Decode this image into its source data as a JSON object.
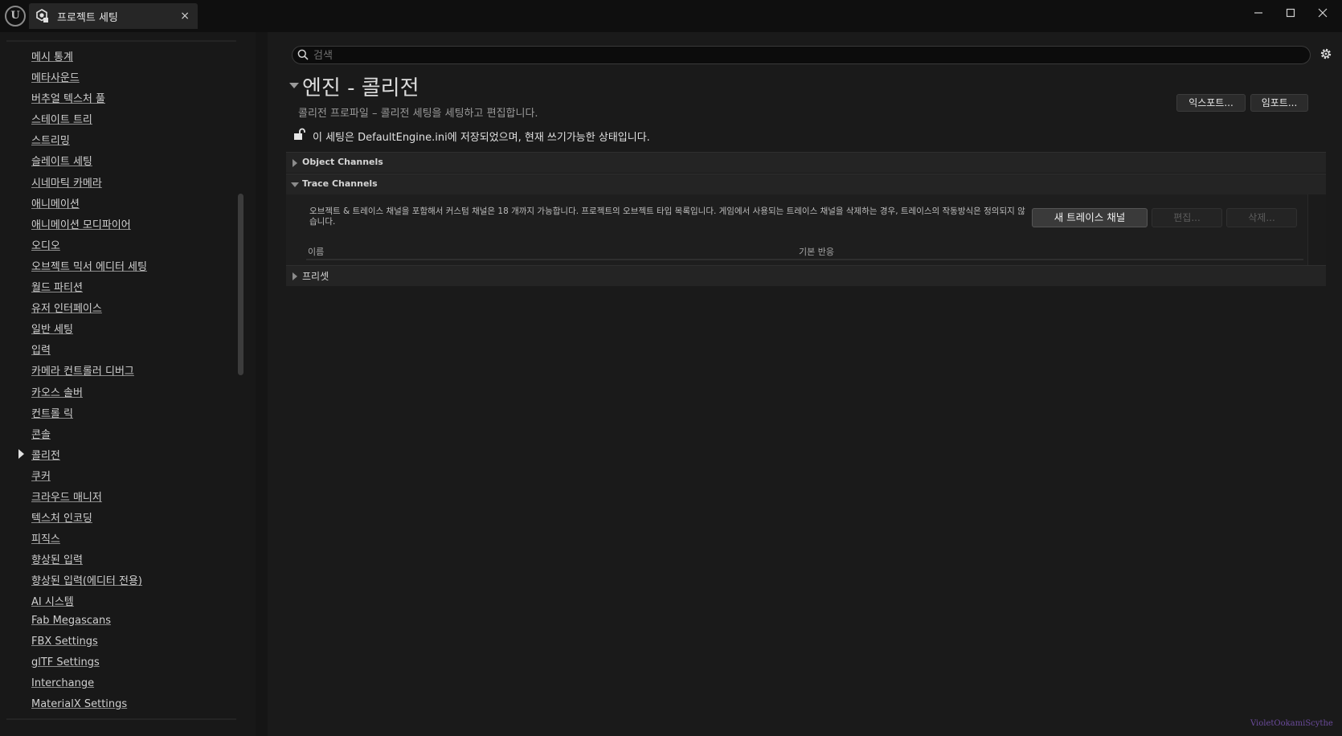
{
  "titlebar": {
    "tab_label": "프로젝트 세팅",
    "tab_close": "×",
    "logo_text": "U"
  },
  "sidebar": {
    "items": [
      {
        "label": "메시 통계"
      },
      {
        "label": "메타사운드"
      },
      {
        "label": "버추얼 텍스처 풀"
      },
      {
        "label": "스테이트 트리"
      },
      {
        "label": "스트리밍"
      },
      {
        "label": "슬레이트 세팅"
      },
      {
        "label": "시네마틱 카메라"
      },
      {
        "label": "애니메이션"
      },
      {
        "label": "애니메이션 모디파이어"
      },
      {
        "label": "오디오"
      },
      {
        "label": "오브젝트 믹서 에디터 세팅"
      },
      {
        "label": "월드 파티션"
      },
      {
        "label": "유저 인터페이스"
      },
      {
        "label": "일반 세팅"
      },
      {
        "label": "입력"
      },
      {
        "label": "카메라 컨트롤러 디버그"
      },
      {
        "label": "카오스 솔버"
      },
      {
        "label": "컨트롤 릭"
      },
      {
        "label": "콘솔"
      },
      {
        "label": "콜리전",
        "selected": true
      },
      {
        "label": "쿠커"
      },
      {
        "label": "크라우드 매니저"
      },
      {
        "label": "텍스처 인코딩"
      },
      {
        "label": "피직스"
      },
      {
        "label": "향상된 입력"
      },
      {
        "label": "향상된 입력(에디터 전용)"
      },
      {
        "label": "AI 시스템"
      },
      {
        "label": "Fab Megascans"
      },
      {
        "label": "FBX Settings"
      },
      {
        "label": "glTF Settings"
      },
      {
        "label": "Interchange"
      },
      {
        "label": "MaterialX Settings"
      }
    ]
  },
  "search": {
    "placeholder": "검색",
    "value": ""
  },
  "page": {
    "title": "엔진 - 콜리전",
    "description": "콜리전 프로파일 – 콜리전 세팅을 세팅하고 편집합니다.",
    "export_label": "익스포트...",
    "import_label": "임포트...",
    "lock_message": "이 세팅은 DefaultEngine.ini에 저장되었으며, 현재 쓰기가능한 상태입니다."
  },
  "categories": {
    "object_channels": "Object Channels",
    "trace_channels": "Trace Channels",
    "presets": "프리셋"
  },
  "trace": {
    "description": "오브젝트 & 트레이스 채널을 포함해서 커스텀 채널은 18 개까지 가능합니다. 프로젝트의 오브젝트 타입 목록입니다. 게임에서 사용되는 트레이스 채널을 삭제하는 경우, 트레이스의 작동방식은 정의되지 않습니다.",
    "new_button": "새 트레이스 채널",
    "edit_button": "편집...",
    "delete_button": "삭제...",
    "col_name": "이름",
    "col_default": "기본 반응"
  },
  "watermark": "VioletOokamiScythe",
  "colors": {
    "background": "#151515",
    "panel": "#1a1a1a",
    "category": "#242424",
    "watermark": "#6a4a9a"
  }
}
